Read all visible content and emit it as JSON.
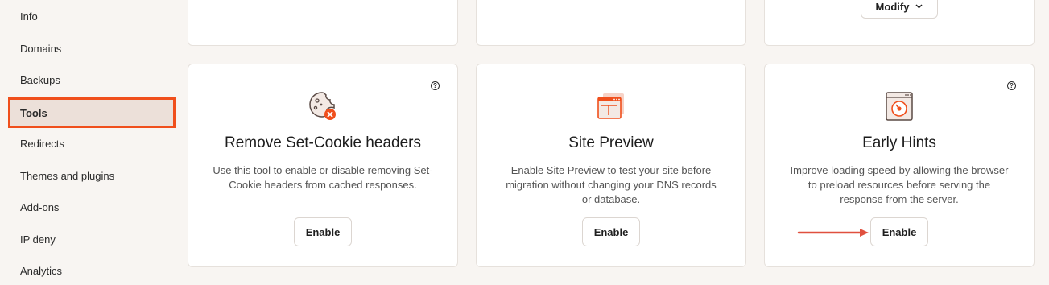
{
  "sidebar": {
    "items": [
      {
        "label": "Info"
      },
      {
        "label": "Domains"
      },
      {
        "label": "Backups"
      },
      {
        "label": "Tools"
      },
      {
        "label": "Redirects"
      },
      {
        "label": "Themes and plugins"
      },
      {
        "label": "Add-ons"
      },
      {
        "label": "IP deny"
      },
      {
        "label": "Analytics"
      }
    ],
    "active": "Tools"
  },
  "top_cards": {
    "modify_label": "Modify"
  },
  "cards": [
    {
      "title": "Remove Set-Cookie headers",
      "description": "Use this tool to enable or disable removing Set-Cookie headers from cached responses.",
      "button": "Enable",
      "icon": "cookie-remove-icon",
      "help": "?"
    },
    {
      "title": "Site Preview",
      "description": "Enable Site Preview to test your site before migration without changing your DNS records or database.",
      "button": "Enable",
      "icon": "browser-windows-icon"
    },
    {
      "title": "Early Hints",
      "description": "Improve loading speed by allowing the browser to preload resources before serving the response from the server.",
      "button": "Enable",
      "icon": "browser-speed-icon",
      "help": "?"
    }
  ],
  "colors": {
    "accent": "#f04f1c",
    "active_bg": "#ece0d9",
    "page_bg": "#f8f5f2",
    "arrow": "#e0503e"
  }
}
